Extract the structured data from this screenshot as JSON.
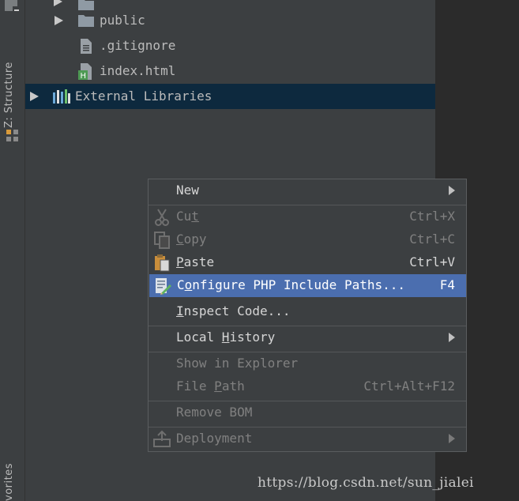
{
  "side_tabs": {
    "structure": "Z: Structure",
    "favorites": "vorites"
  },
  "tree": {
    "items": [
      {
        "label": "public",
        "icon": "folder-icon"
      },
      {
        "label": ".gitignore",
        "icon": "text-file-icon"
      },
      {
        "label": "index.html",
        "icon": "html-file-icon"
      },
      {
        "label": "External Libraries",
        "icon": "libraries-icon",
        "selected": true
      }
    ]
  },
  "context_menu": {
    "new": {
      "label": "New"
    },
    "cut": {
      "label_pre": "Cu",
      "label_u": "t",
      "label_post": "",
      "shortcut": "Ctrl+X"
    },
    "copy": {
      "label_pre": "",
      "label_u": "C",
      "label_post": "opy",
      "shortcut": "Ctrl+C"
    },
    "paste": {
      "label_pre": "",
      "label_u": "P",
      "label_post": "aste",
      "shortcut": "Ctrl+V"
    },
    "configure": {
      "label_pre": "C",
      "label_u": "o",
      "label_post": "nfigure PHP Include Paths...",
      "shortcut": "F4"
    },
    "inspect": {
      "label_pre": "",
      "label_u": "I",
      "label_post": "nspect Code..."
    },
    "local_history": {
      "label_pre": "Local ",
      "label_u": "H",
      "label_post": "istory"
    },
    "show_in_explorer": {
      "label": "Show in Explorer"
    },
    "file_path": {
      "label_pre": "File ",
      "label_u": "P",
      "label_post": "ath",
      "shortcut": "Ctrl+Alt+F12"
    },
    "remove_bom": {
      "label": "Remove BOM"
    },
    "deployment": {
      "label": "Deployment"
    }
  },
  "watermark": "https://blog.csdn.net/sun_jialei",
  "colors": {
    "panel_bg": "#3c3f41",
    "editor_bg": "#2b2b2b",
    "selection_bg": "#0d293e",
    "menu_highlight": "#4b6eaf",
    "disabled_text": "#808080"
  }
}
